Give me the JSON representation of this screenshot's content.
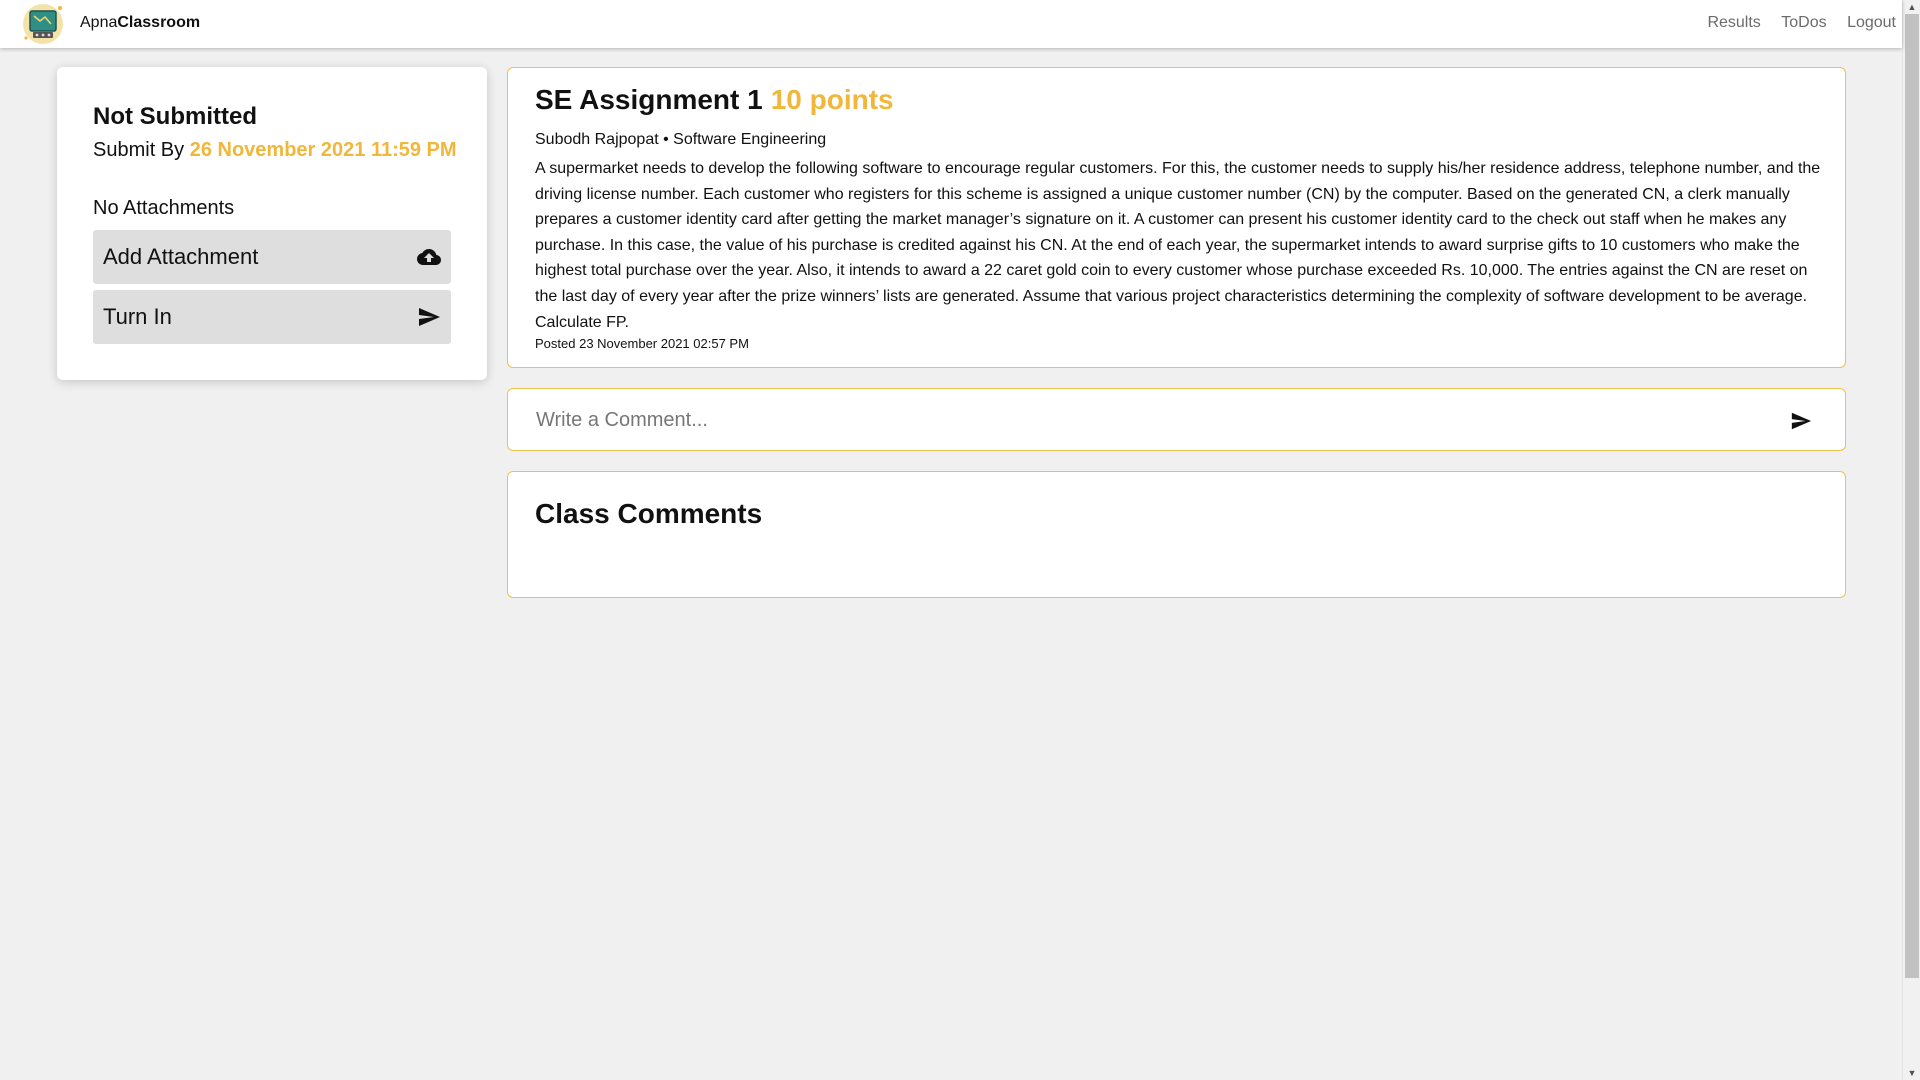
{
  "navbar": {
    "brand_prefix": "Apna",
    "brand_bold": "Classroom",
    "logo_icon": "classroom-board-logo",
    "links": [
      "Results",
      "ToDos",
      "Logout"
    ]
  },
  "status": {
    "title": "Not Submitted",
    "submit_by_label": "Submit By",
    "due_date": "26 November 2021 11:59 PM",
    "attachments_text": "No Attachments",
    "add_attachment_label": "Add Attachment",
    "add_attachment_icon": "cloud-upload-icon",
    "turn_in_label": "Turn In",
    "turn_in_icon": "send-icon"
  },
  "assignment": {
    "title": "SE Assignment 1",
    "points": "10 points",
    "meta": "Subodh Rajpopat • Software Engineering",
    "description": "A supermarket needs to develop the following software to encourage regular customers. For this, the customer needs to supply his/her residence address, telephone number, and the driving license number. Each customer who registers for this scheme is assigned a unique customer number (CN) by the computer. Based on the generated CN, a clerk manually prepares a customer identity card after getting the market manager’s signature on it. A customer can present his customer identity card to the check out staff when he makes any purchase. In this case, the value of his purchase is credited against his CN. At the end of each year, the supermarket intends to award surprise gifts to 10 customers who make the highest total purchase over the year. Also, it intends to award a 22 caret gold coin to every customer whose purchase exceeded Rs. 10,000. The entries against the CN are reset on the last day of every year after the prize winners’ lists are generated. Assume that various project characteristics determining the complexity of software development to be average. Calculate FP.",
    "posted": "Posted 23 November 2021 02:57 PM"
  },
  "comment": {
    "placeholder": "Write a Comment...",
    "value": ""
  },
  "class_comments": {
    "title": "Class Comments"
  },
  "colors": {
    "accent": "#f0b73a",
    "card_border": "#f0c14b",
    "page_bg": "#f0f0f0",
    "button_bg": "#dedede"
  }
}
